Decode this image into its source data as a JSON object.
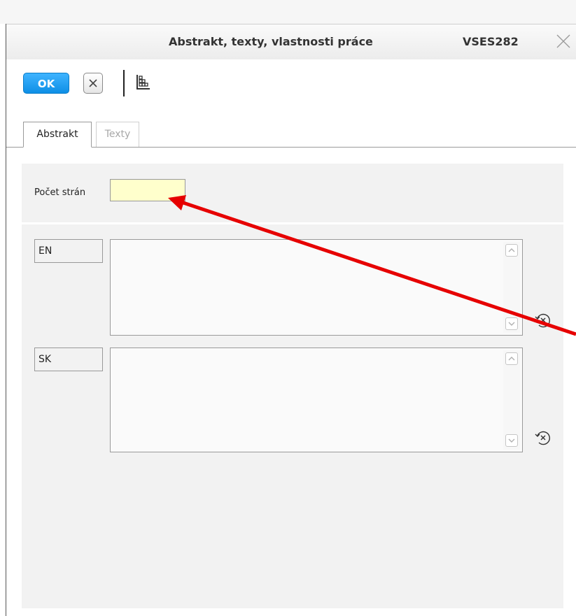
{
  "window": {
    "title": "Abstrakt, texty, vlastnosti práce",
    "code": "VSES282"
  },
  "toolbar": {
    "ok_label": "OK"
  },
  "tabs": [
    {
      "label": "Abstrakt",
      "active": true
    },
    {
      "label": "Texty",
      "active": false
    }
  ],
  "form": {
    "page_count_label": "Počet strán",
    "page_count_value": "",
    "abstracts": [
      {
        "lang": "EN",
        "text": ""
      },
      {
        "lang": "SK",
        "text": ""
      }
    ]
  },
  "colors": {
    "ok_button": "#1a9cf0",
    "input_highlight": "#ffffcc",
    "annotation_arrow": "#e60000",
    "panel_bg": "#f2f2f2"
  },
  "icons": {
    "close": "close-icon",
    "cancel": "x-icon",
    "grid": "grid-icon",
    "clear_text": "clear-text-icon"
  }
}
